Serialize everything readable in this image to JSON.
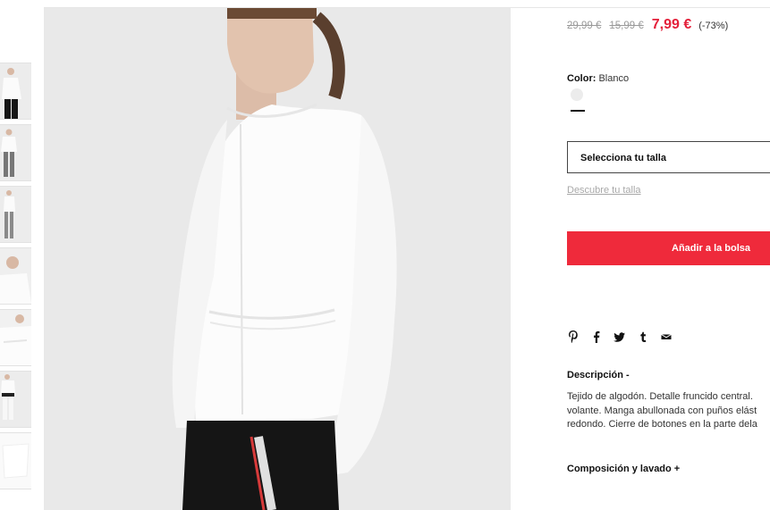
{
  "product": {
    "prices": {
      "original": "29,99 €",
      "previous": "15,99 €",
      "current": "7,99 €",
      "discount": "(-73%)"
    },
    "color": {
      "label": "Color:",
      "value": "Blanco"
    },
    "size": {
      "placeholder": "Selecciona tu talla",
      "guide_link": "Descubre tu talla"
    },
    "add_to_bag": "Añadir a la bolsa",
    "share_icons": [
      "pinterest-icon",
      "facebook-icon",
      "twitter-icon",
      "tumblr-icon",
      "email-icon"
    ],
    "description": {
      "title": "Descripción -",
      "lines": [
        "Tejido de algodón. Detalle fruncido central.",
        "volante. Manga abullonada con puños elást",
        "redondo. Cierre de botones en la parte dela"
      ]
    },
    "composition": {
      "title": "Composición y lavado +"
    }
  },
  "gallery": {
    "thumbnail_count": 7
  },
  "colors": {
    "accent": "#ef2a3b",
    "price": "#e4203a",
    "muted": "#a8a8a8"
  }
}
